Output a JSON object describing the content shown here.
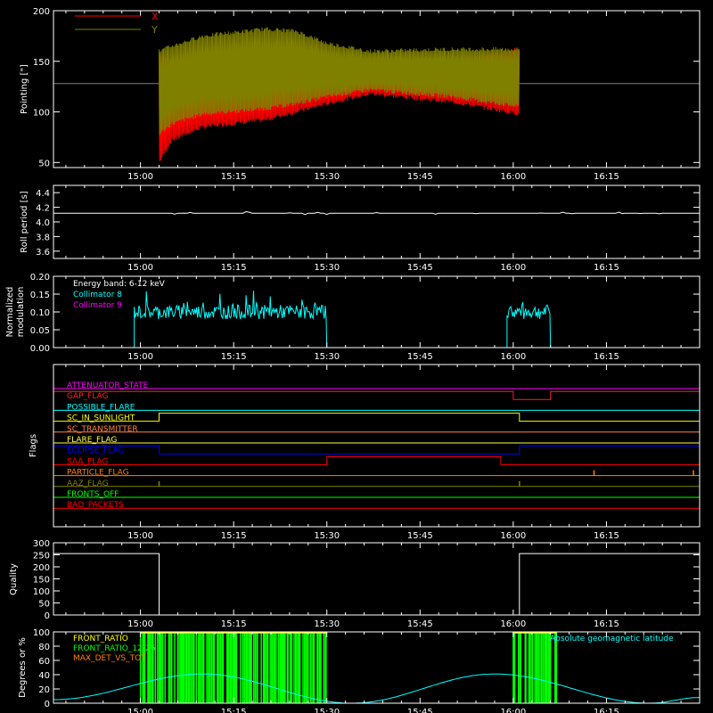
{
  "time_axis": {
    "ticks": [
      "15:00",
      "15:15",
      "15:30",
      "15:45",
      "16:00",
      "16:15"
    ]
  },
  "panels": {
    "pointing": {
      "ylabel": "Pointing [\"]",
      "yticks": [
        "50",
        "100",
        "150",
        "200"
      ],
      "legend": [
        {
          "name": "X",
          "color": "#ff0000"
        },
        {
          "name": "Y",
          "color": "#808000"
        }
      ]
    },
    "roll": {
      "ylabel": "Roll period [s]",
      "yticks": [
        "3.6",
        "3.8",
        "4.0",
        "4.2",
        "4.4"
      ]
    },
    "modulation": {
      "ylabel_1": "Normalized",
      "ylabel_2": "modulation",
      "yticks": [
        "0.00",
        "0.05",
        "0.10",
        "0.15",
        "0.20"
      ],
      "legend": [
        {
          "name": "Energy band: 6-12 keV",
          "color": "#ffffff"
        },
        {
          "name": "Collimator 8",
          "color": "#00ffff"
        },
        {
          "name": "Collimator 9",
          "color": "#ff00ff"
        }
      ]
    },
    "flags": {
      "ylabel": "Flags",
      "items": [
        {
          "name": "ATTENUATOR_STATE",
          "color": "#ff00ff"
        },
        {
          "name": "GAP_FLAG",
          "color": "#ff2020"
        },
        {
          "name": "POSSIBLE_FLARE",
          "color": "#00ffff"
        },
        {
          "name": "SC_IN_SUNLIGHT",
          "color": "#ffff00"
        },
        {
          "name": "SC_TRANSMITTER",
          "color": "#ff8040"
        },
        {
          "name": "FLARE_FLAG",
          "color": "#ffff40"
        },
        {
          "name": "ECLIPSE_FLAG",
          "color": "#0000ff"
        },
        {
          "name": "SAA_FLAG",
          "color": "#ff0000"
        },
        {
          "name": "PARTICLE_FLAG",
          "color": "#ff8000"
        },
        {
          "name": "AAZ_FLAG",
          "color": "#808000"
        },
        {
          "name": "FRONTS_OFF",
          "color": "#00ff00"
        },
        {
          "name": "BAD_PACKETS",
          "color": "#ff0000"
        }
      ]
    },
    "quality": {
      "ylabel": "Quality",
      "yticks": [
        "0",
        "50",
        "100",
        "150",
        "200",
        "250",
        "300"
      ]
    },
    "geo": {
      "ylabel": "Degrees or %",
      "yticks": [
        "0",
        "20",
        "40",
        "60",
        "80",
        "100"
      ],
      "legend": [
        {
          "name": "FRONT_RATIO",
          "color": "#ffff00"
        },
        {
          "name": "FRONT_RATIO_12-25",
          "color": "#00ff00"
        },
        {
          "name": "MAX_DET_VS_TOT",
          "color": "#ff8000"
        }
      ],
      "right_legend": {
        "name": "Absolute geomagnetic latitude",
        "color": "#00ffff"
      }
    }
  },
  "chart_data": [
    {
      "type": "line",
      "panel": "pointing",
      "x_range": [
        "14:46",
        "16:30"
      ],
      "ylim": [
        45,
        200
      ],
      "reference_level": 128,
      "data_start": "15:03",
      "data_end": "16:01",
      "series": [
        {
          "name": "X",
          "color": "#ff0000",
          "envelope_time": [
            "15:03",
            "15:05",
            "15:10",
            "15:20",
            "15:30",
            "15:37",
            "15:50",
            "16:01"
          ],
          "upper": [
            160,
            150,
            145,
            150,
            148,
            145,
            150,
            162
          ],
          "lower": [
            50,
            72,
            85,
            92,
            108,
            118,
            110,
            98
          ]
        },
        {
          "name": "Y",
          "color": "#808000",
          "envelope_time": [
            "15:03",
            "15:05",
            "15:10",
            "15:20",
            "15:25",
            "15:30",
            "15:37",
            "15:50",
            "16:01"
          ],
          "upper": [
            160,
            165,
            175,
            182,
            180,
            168,
            160,
            162,
            162
          ],
          "lower": [
            78,
            88,
            98,
            103,
            108,
            115,
            122,
            115,
            105
          ]
        }
      ]
    },
    {
      "type": "line",
      "panel": "roll",
      "x_range": [
        "14:46",
        "16:30"
      ],
      "ylim": [
        3.5,
        4.5
      ],
      "series": [
        {
          "name": "",
          "color": "#ffffff",
          "constant": 4.12
        }
      ]
    },
    {
      "type": "line",
      "panel": "modulation",
      "x_range": [
        "14:46",
        "16:30"
      ],
      "ylim": [
        0,
        0.2
      ],
      "series": [
        {
          "name": "Collimator 8",
          "color": "#00ffff",
          "active_intervals": [
            [
              "14:59",
              "15:30"
            ],
            [
              "15:59",
              "16:06"
            ]
          ],
          "level": 0.1,
          "spread": 0.02
        },
        {
          "name": "Collimator 9",
          "color": "#ff00ff",
          "constant": 0.0
        }
      ]
    },
    {
      "type": "line",
      "panel": "flags",
      "x_range": [
        "14:46",
        "16:30"
      ],
      "series": [
        {
          "name": "ATTENUATOR_STATE",
          "steps": [
            [
              "14:46",
              0
            ]
          ]
        },
        {
          "name": "GAP_FLAG",
          "steps": [
            [
              "14:46",
              1
            ],
            [
              "16:00",
              0
            ],
            [
              "16:06",
              1
            ]
          ]
        },
        {
          "name": "POSSIBLE_FLARE",
          "steps": [
            [
              "14:46",
              0
            ]
          ]
        },
        {
          "name": "SC_IN_SUNLIGHT",
          "steps": [
            [
              "14:46",
              0
            ],
            [
              "15:03",
              1
            ],
            [
              "16:01",
              0
            ]
          ]
        },
        {
          "name": "SC_TRANSMITTER",
          "steps": [
            [
              "14:46",
              0
            ]
          ]
        },
        {
          "name": "FLARE_FLAG",
          "steps": [
            [
              "14:46",
              0
            ]
          ]
        },
        {
          "name": "ECLIPSE_FLAG",
          "steps": [
            [
              "14:46",
              1
            ],
            [
              "15:03",
              0
            ],
            [
              "16:01",
              1
            ]
          ]
        },
        {
          "name": "SAA_FLAG",
          "steps": [
            [
              "14:46",
              0
            ],
            [
              "15:30",
              1
            ],
            [
              "15:58",
              0
            ]
          ]
        },
        {
          "name": "PARTICLE_FLAG",
          "steps": [
            [
              "14:46",
              0
            ]
          ],
          "spikes": [
            "16:13",
            "16:29"
          ]
        },
        {
          "name": "AAZ_FLAG",
          "steps": [
            [
              "14:46",
              0
            ]
          ],
          "spikes": [
            "15:03",
            "16:01"
          ]
        },
        {
          "name": "FRONTS_OFF",
          "steps": [
            [
              "14:46",
              0
            ]
          ]
        },
        {
          "name": "BAD_PACKETS",
          "steps": [
            [
              "14:46",
              0
            ]
          ]
        }
      ]
    },
    {
      "type": "line",
      "panel": "quality",
      "x_range": [
        "14:46",
        "16:30"
      ],
      "ylim": [
        0,
        300
      ],
      "series": [
        {
          "name": "",
          "color": "#ffffff",
          "steps": [
            [
              "14:46",
              255
            ],
            [
              "15:03",
              0
            ],
            [
              "16:01",
              255
            ],
            [
              "16:30",
              255
            ]
          ]
        }
      ]
    },
    {
      "type": "line",
      "panel": "geo",
      "x_range": [
        "14:46",
        "16:30"
      ],
      "ylim": [
        0,
        100
      ],
      "series": [
        {
          "name": "Absolute geomagnetic latitude",
          "color": "#00ffff",
          "time": [
            "14:46",
            "15:10",
            "15:34",
            "15:57",
            "16:22",
            "16:30"
          ],
          "values": [
            5,
            41,
            0,
            41,
            0,
            8
          ]
        },
        {
          "name": "FRONT_RATIO_12-25",
          "color": "#00ff00",
          "active_intervals": [
            [
              "15:00",
              "15:30"
            ],
            [
              "16:00",
              "16:07"
            ]
          ]
        },
        {
          "name": "FRONT_RATIO",
          "color": "#ffff00",
          "active_intervals": [
            [
              "15:00",
              "15:30"
            ],
            [
              "16:00",
              "16:07"
            ]
          ],
          "level": 99
        },
        {
          "name": "MAX_DET_VS_TOT",
          "color": "#ff8000",
          "constant": 0
        }
      ]
    }
  ]
}
